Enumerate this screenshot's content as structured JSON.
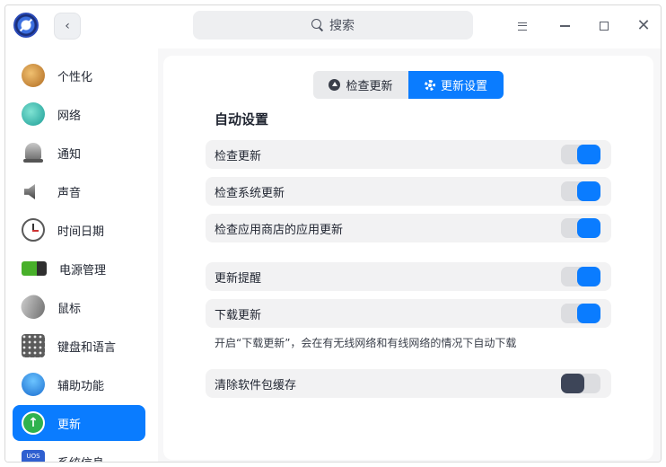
{
  "titlebar": {
    "search_placeholder": "搜索"
  },
  "sidebar": {
    "items": [
      {
        "label": "个性化",
        "icon": "personalization-icon"
      },
      {
        "label": "网络",
        "icon": "network-icon"
      },
      {
        "label": "通知",
        "icon": "bell-icon"
      },
      {
        "label": "声音",
        "icon": "speaker-icon"
      },
      {
        "label": "时间日期",
        "icon": "clock-icon"
      },
      {
        "label": "电源管理",
        "icon": "battery-icon"
      },
      {
        "label": "鼠标",
        "icon": "mouse-icon"
      },
      {
        "label": "键盘和语言",
        "icon": "keyboard-icon"
      },
      {
        "label": "辅助功能",
        "icon": "accessibility-icon"
      },
      {
        "label": "更新",
        "icon": "update-icon",
        "active": true
      },
      {
        "label": "系统信息",
        "icon": "system-info-icon",
        "badge": "UOS"
      }
    ]
  },
  "tabs": {
    "check_update": "检查更新",
    "update_settings": "更新设置",
    "active": "update_settings"
  },
  "auto": {
    "title": "自动设置",
    "check_updates": {
      "label": "检查更新",
      "enabled": true
    },
    "check_system_updates": {
      "label": "检查系统更新",
      "enabled": true
    },
    "check_store_updates": {
      "label": "检查应用商店的应用更新",
      "enabled": true
    },
    "update_reminder": {
      "label": "更新提醒",
      "enabled": true
    },
    "download_updates": {
      "label": "下载更新",
      "enabled": true
    },
    "download_hint": "开启“下载更新”，会在有无线网络和有线网络的情况下自动下载",
    "clear_cache": {
      "label": "清除软件包缓存",
      "enabled": false
    }
  },
  "colors": {
    "accent": "#0a7cff",
    "toggle_off_knob": "#3d4558",
    "row_background": "#f2f2f3"
  }
}
